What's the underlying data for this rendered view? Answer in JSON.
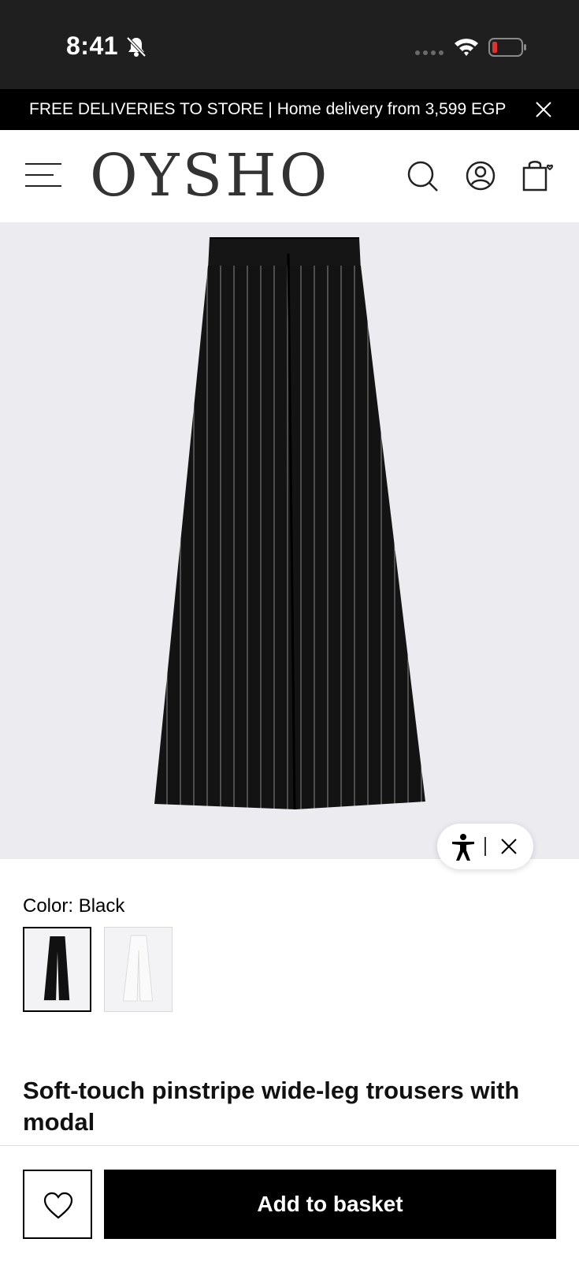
{
  "status_bar": {
    "time": "8:41",
    "bell_icon": "bell-muted-icon",
    "wifi_icon": "wifi-icon",
    "battery_icon": "battery-low-icon",
    "battery_color": "#e0312e"
  },
  "promo": {
    "text": "FREE DELIVERIES TO STORE | Home delivery from 3,599 EGP",
    "close_icon": "close-icon"
  },
  "header": {
    "logo": "OYSHO",
    "menu_icon": "hamburger-menu-icon",
    "search_icon": "search-icon",
    "account_icon": "account-icon",
    "bag_icon": "shopping-bag-icon"
  },
  "product": {
    "image_icon": "pinstripe-trousers-image",
    "color_label": "Color:",
    "color_value": "Black",
    "swatches": [
      {
        "name": "Black",
        "selected": true
      },
      {
        "name": "White",
        "selected": false
      }
    ],
    "title": "Soft-touch pinstripe wide-leg trousers with modal"
  },
  "accessibility_widget": {
    "icon": "accessibility-icon",
    "close_icon": "close-icon"
  },
  "actions": {
    "wishlist_icon": "heart-icon",
    "add_to_basket": "Add to basket"
  },
  "colors": {
    "primary": "#000000",
    "image_background": "#ecebf0",
    "status_bar": "#1f1f1f"
  }
}
